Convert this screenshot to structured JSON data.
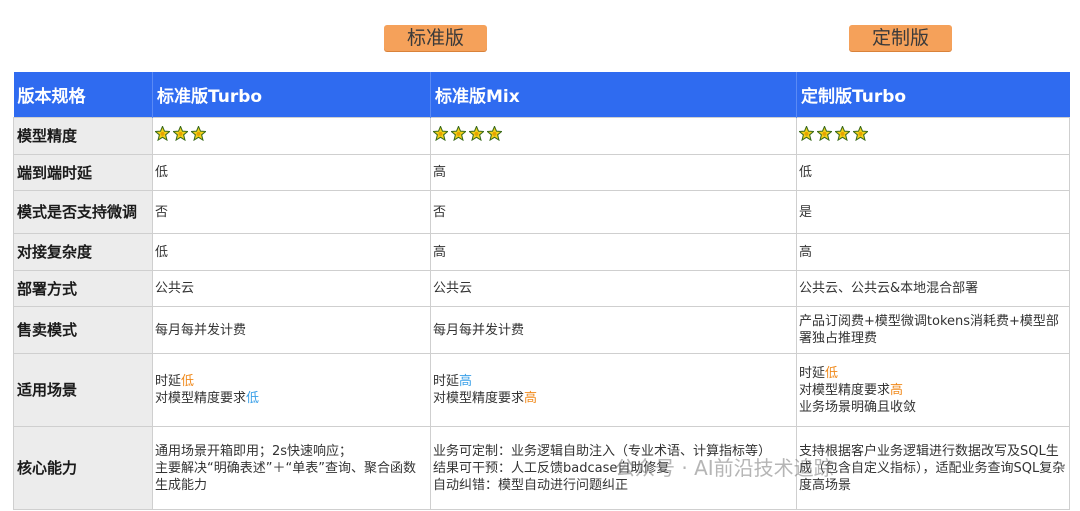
{
  "header_badges": {
    "standard": "标准版",
    "custom": "定制版"
  },
  "colors": {
    "header_bg": "#2f6bf0",
    "badge_bg": "#f5a15a",
    "low": "#3aa0e8",
    "high": "#f08a1c"
  },
  "table": {
    "columns": [
      "版本规格",
      "标准版Turbo",
      "标准版Mix",
      "定制版Turbo"
    ],
    "rows": [
      {
        "label": "模型精度",
        "turbo_stars": 3,
        "mix_stars": 4,
        "custom_stars": 4
      },
      {
        "label": "端到端时延",
        "turbo": "低",
        "mix": "高",
        "custom": "低"
      },
      {
        "label": "模式是否支持微调",
        "turbo": "否",
        "mix": "否",
        "custom": "是"
      },
      {
        "label": "对接复杂度",
        "turbo": "低",
        "mix": "高",
        "custom": "高"
      },
      {
        "label": "部署方式",
        "turbo": "公共云",
        "mix": "公共云",
        "custom": "公共云、公共云&本地混合部署"
      },
      {
        "label": "售卖模式",
        "turbo": "每月每并发计费",
        "mix": "每月每并发计费",
        "custom": "产品订阅费+模型微调tokens消耗费+模型部署独占推理费"
      },
      {
        "label": "适用场景",
        "turbo": {
          "l1_prefix": "时延",
          "l1_val": "低",
          "l2_prefix": "对模型精度要求",
          "l2_val": "低"
        },
        "mix": {
          "l1_prefix": "时延",
          "l1_val": "高",
          "l2_prefix": "对模型精度要求",
          "l2_val": "高"
        },
        "custom": {
          "l1_prefix": "时延",
          "l1_val": "低",
          "l2_prefix": "对模型精度要求",
          "l2_val": "高",
          "l3": "业务场景明确且收敛"
        }
      },
      {
        "label": "核心能力",
        "turbo": [
          "通用场景开箱即用；2s快速响应；",
          "主要解决“明确表述”＋“单表”查询、聚合函数生成能力"
        ],
        "mix": [
          "业务可定制：业务逻辑自助注入（专业术语、计算指标等）",
          "结果可干预：人工反馈badcase自助修复",
          "自动纠错：模型自动进行问题纠正"
        ],
        "custom": [
          "支持根据客户业务逻辑进行数据改写及SQL生成（包含自定义指标），适配业务查询SQL复杂度高场景"
        ]
      }
    ]
  },
  "watermark": "公众号 · AI前沿技术追踪"
}
